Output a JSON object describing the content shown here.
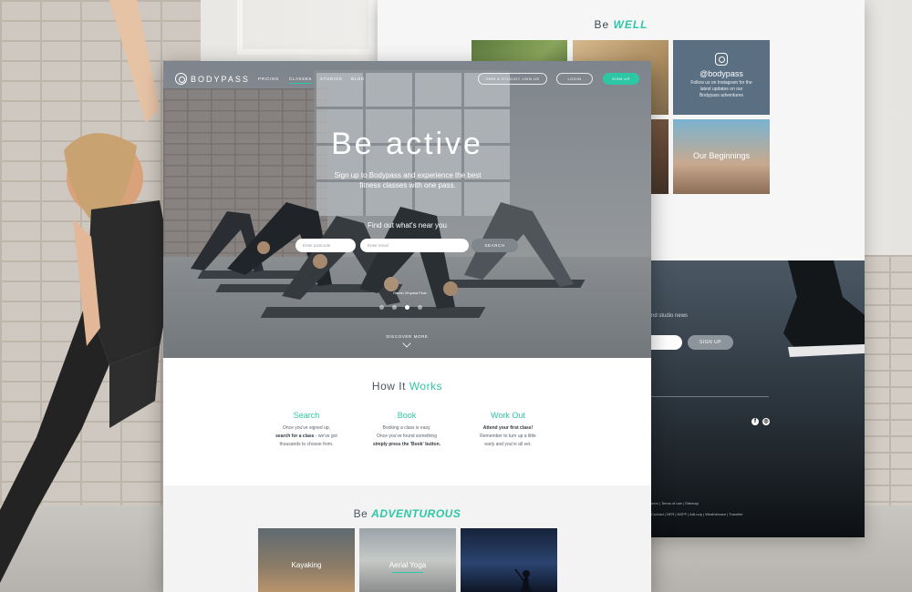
{
  "back_page": {
    "heading_prefix": "Be",
    "heading_accent": "WELL",
    "instagram": {
      "handle": "@bodypass",
      "text": "Follow us on Instagram for the latest updates on our Bodypass adventures"
    },
    "tile_label": "Our Beginnings",
    "news_text": "nd studio news",
    "signup_label": "SIGN UP",
    "social_icons": [
      "facebook-icon",
      "instagram-icon"
    ],
    "footer_links_1": "ners | Terms of use | Sitemap",
    "footer_links_2": "Contact | NFR | NSFP | AdLoop | Weathercare | Traveller"
  },
  "nav": {
    "brand": "BODYPASS",
    "items": [
      "PRICING",
      "CLASSES",
      "STUDIOS",
      "BLOG"
    ],
    "active_item": "CLASSES",
    "studio_button": "OWN A STUDIO? JOIN US",
    "login_button": "LOGIN",
    "signup_button": "SIGN UP"
  },
  "hero": {
    "title": "Be active",
    "subtitle": "Sign up to Bodypass and experience the best fitness classes with one pass.",
    "find_text": "Find out what's near you",
    "postcode_placeholder": "Enter postcode",
    "email_placeholder": "Enter email",
    "search_label": "SEARCH",
    "caption": "Ocean Vinyasa Flow",
    "slides_total": 4,
    "slide_active": 3,
    "discover_label": "DISCOVER MORE"
  },
  "how": {
    "title_prefix": "How It",
    "title_accent": "Works",
    "columns": [
      {
        "heading": "Search",
        "line1": "Once you've signed up,",
        "line2_bold": "search for a class",
        "line2_rest": " - we've got",
        "line3": "thousands to choose from."
      },
      {
        "heading": "Book",
        "line1": "Booking a class is easy.",
        "line2_rest": "Once you've found something",
        "line3_bold": "simply press the 'Book' button."
      },
      {
        "heading": "Work Out",
        "line1_bold": "Attend your first class!",
        "line2_rest": "Remember to turn up a little",
        "line3": "early and you're all set."
      }
    ]
  },
  "adventurous": {
    "title_prefix": "Be",
    "title_accent": "ADVENTUROUS",
    "cards": [
      "Kayaking",
      "Aerial Yoga",
      ""
    ]
  },
  "colors": {
    "accent": "#2ec7a6",
    "text_dark": "#4a5560"
  }
}
